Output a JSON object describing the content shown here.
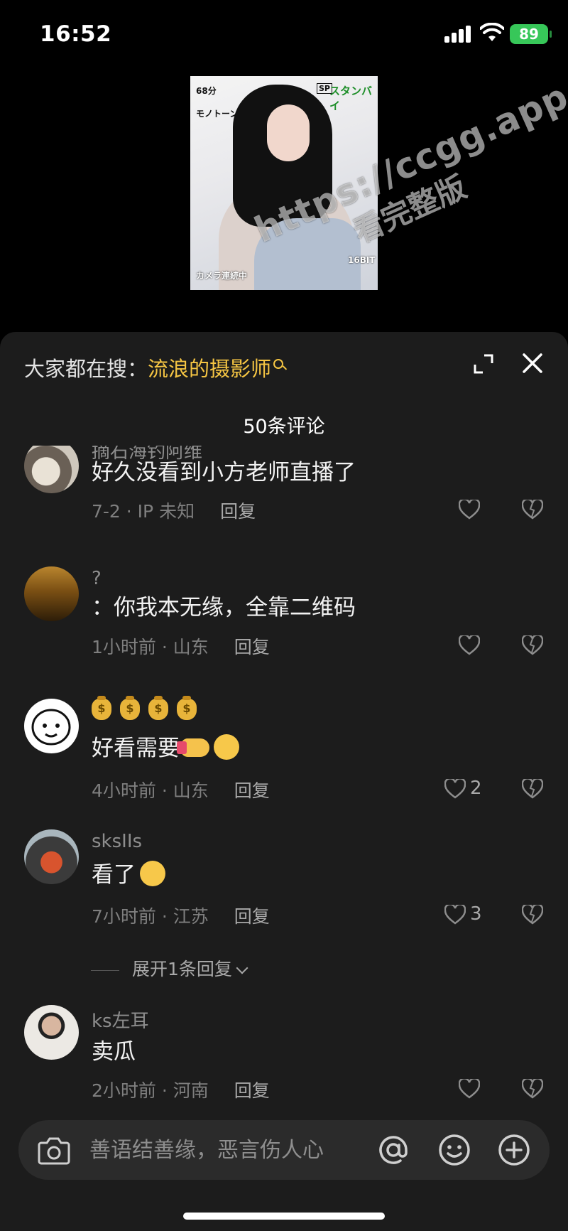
{
  "status_bar": {
    "time": "16:52",
    "battery": "89"
  },
  "video": {
    "hud_top_left_1": "68分",
    "hud_top_left_2": "モノトーン",
    "hud_top_right": "スタンバイ",
    "hud_sp": "SP",
    "hud_bottom_left": "カメラ連続中",
    "hud_bottom_right": "16BIT"
  },
  "watermark": {
    "line1": "https://ccgg.app",
    "line2": "看完整版"
  },
  "sheet": {
    "search_prefix": "大家都在搜：",
    "search_term": "流浪的摄影师",
    "comment_count_title": "50条评论"
  },
  "comments": [
    {
      "username": "摘石海钓阿维",
      "text": "好久没看到小方老师直播了",
      "meta": "7-2 · IP 未知",
      "reply_label": "回复",
      "likes": ""
    },
    {
      "username": "?",
      "text": "：你我本无缘，全靠二维码",
      "meta": "1小时前 · 山东",
      "reply_label": "回复",
      "likes": ""
    },
    {
      "username": "",
      "text": "好看需要",
      "meta": "4小时前 · 山东",
      "reply_label": "回复",
      "likes": "2"
    },
    {
      "username": "sksIIs",
      "text": "看了",
      "meta": "7小时前 · 江苏",
      "reply_label": "回复",
      "likes": "3"
    },
    {
      "username": "ks左耳",
      "text": "卖瓜",
      "meta": "2小时前 · 河南",
      "reply_label": "回复",
      "likes": ""
    }
  ],
  "expand_replies_label": "展开1条回复",
  "input": {
    "placeholder": "善语结善缘，恶言伤人心"
  },
  "colors": {
    "background": "#000000",
    "sheet": "#1c1c1c",
    "accent_yellow": "#f5c543",
    "battery_green": "#37c759"
  },
  "icons": [
    "signal-icon",
    "wifi-icon",
    "expand-icon",
    "close-icon",
    "search-icon",
    "heart-icon",
    "dislike-icon",
    "camera-icon",
    "at-icon",
    "emoji-icon",
    "plus-icon"
  ]
}
